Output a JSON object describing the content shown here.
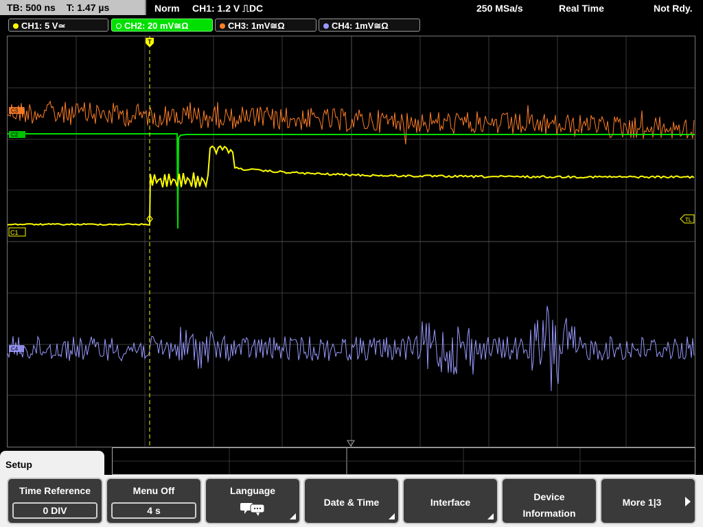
{
  "status": {
    "timebase": "TB: 500 ns",
    "trigger_time": "T: 1.47 µs",
    "mode": "Norm",
    "trigger": "CH1: 1.2 V ⎍DC",
    "sample_rate": "250 MSa/s",
    "acq_mode": "Real Time",
    "state": "Not Rdy."
  },
  "channels": [
    {
      "label": "CH1: 5 V≃",
      "color": "#ffff00",
      "active": false
    },
    {
      "label": "CH2: 20 mV≅Ω",
      "color": "#00e000",
      "active": true
    },
    {
      "label": "CH3: 1mV≅Ω",
      "color": "#ff7f27",
      "active": false
    },
    {
      "label": "CH4: 1mV≅Ω",
      "color": "#9999ff",
      "active": false
    }
  ],
  "markers": {
    "c2": "C2",
    "c3": "C3",
    "c1": "C1",
    "c4": "C4",
    "tl": "TL",
    "trigger": "T"
  },
  "menu": {
    "title": "Setup",
    "softkeys": {
      "time_reference": {
        "label": "Time Reference",
        "value": "0 DIV"
      },
      "menu_off": {
        "label": "Menu Off",
        "value": "4 s"
      },
      "language": {
        "label": "Language",
        "icon": "speech-bubbles-icon"
      },
      "date_time": {
        "label": "Date & Time"
      },
      "interface": {
        "label": "Interface"
      },
      "device_info": {
        "line1": "Device",
        "line2": "Information"
      },
      "more": {
        "label": "More 1|3"
      }
    }
  }
}
